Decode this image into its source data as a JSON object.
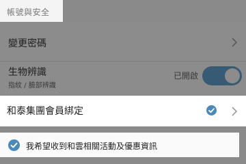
{
  "section_title": "帳號與安全",
  "change_password": {
    "label": "變更密碼"
  },
  "biometrics": {
    "label": "生物辨識",
    "subtitle": "指紋 / 臉部辨識",
    "status": "已開啟",
    "enabled": true
  },
  "member_binding": {
    "label": "和泰集團會員綁定",
    "bound": true
  },
  "consent": {
    "label": "我希望收到和雲相關活動及優惠資訊",
    "checked": true
  },
  "colors": {
    "accent": "#4b89b8",
    "toggle_track": "#375a75",
    "overlay_gray": "#8c8c8c"
  }
}
